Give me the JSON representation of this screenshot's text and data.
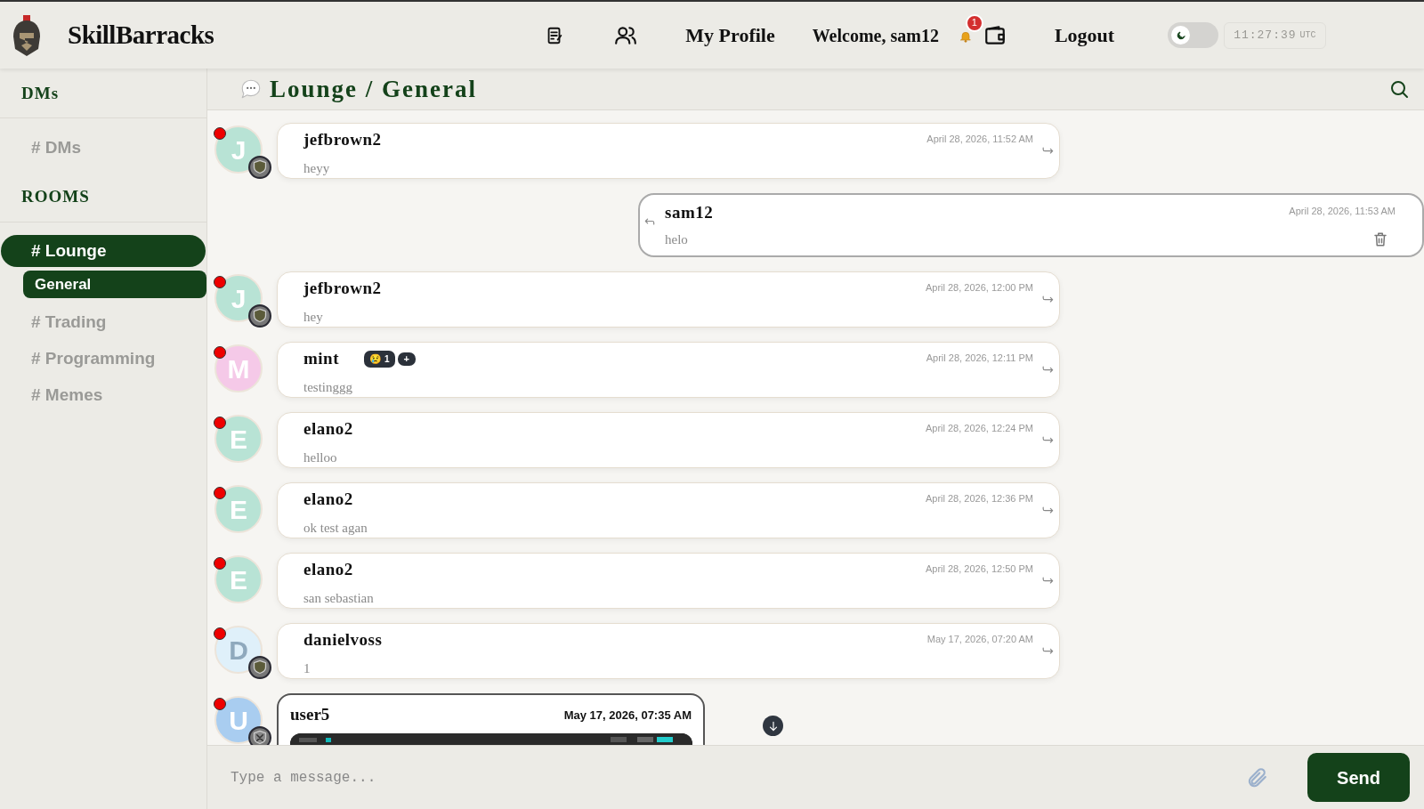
{
  "header": {
    "brand": "SkillBarracks",
    "nav": [
      "My Profile"
    ],
    "welcome": "Welcome, sam12",
    "notifications": "1",
    "logout": "Logout",
    "dark_mode": {
      "on": false
    },
    "clock": {
      "time": "11:27:39",
      "zone": "UTC"
    }
  },
  "sidebar": {
    "sections": [
      {
        "title": "DMs",
        "items": [
          {
            "label": "# DMs",
            "selected": false
          }
        ]
      },
      {
        "title": "ROOMS",
        "items": [
          {
            "label": "# Lounge",
            "selected": true,
            "children": [
              {
                "label": "General",
                "selected": true
              }
            ]
          },
          {
            "label": "# Trading",
            "selected": false
          },
          {
            "label": "# Programming",
            "selected": false
          },
          {
            "label": "# Memes",
            "selected": false
          }
        ]
      }
    ]
  },
  "room": {
    "title": "Lounge / General"
  },
  "messages": [
    {
      "kind": "text",
      "own": false,
      "initial": "J",
      "color": "#b8e3d5",
      "badge": {
        "kind": "shield"
      },
      "user": "jefbrown2",
      "time": "April 28, 2026, 11:52 AM",
      "text": "heyy"
    },
    {
      "kind": "text",
      "own": true,
      "user": "sam12",
      "time": "April 28, 2026, 11:53 AM",
      "text": "helo"
    },
    {
      "kind": "text",
      "own": false,
      "initial": "J",
      "color": "#b8e3d5",
      "badge": {
        "kind": "shield"
      },
      "user": "jefbrown2",
      "time": "April 28, 2026, 12:00 PM",
      "text": "hey"
    },
    {
      "kind": "text",
      "own": false,
      "initial": "M",
      "color": "#f5c9e8",
      "user": "mint",
      "time": "April 28, 2026, 12:11 PM",
      "text": "testinggg",
      "reactions": [
        {
          "emoji": "😢",
          "count": "1"
        }
      ],
      "add_reaction": "+"
    },
    {
      "kind": "text",
      "own": false,
      "initial": "E",
      "color": "#b8e3d5",
      "user": "elano2",
      "time": "April 28, 2026, 12:24 PM",
      "text": "helloo"
    },
    {
      "kind": "text",
      "own": false,
      "initial": "E",
      "color": "#b8e3d5",
      "user": "elano2",
      "time": "April 28, 2026, 12:36 PM",
      "text": "ok test agan"
    },
    {
      "kind": "text",
      "own": false,
      "initial": "E",
      "color": "#b8e3d5",
      "user": "elano2",
      "time": "April 28, 2026, 12:50 PM",
      "text": "san sebastian"
    },
    {
      "kind": "text",
      "own": false,
      "initial": "D",
      "color": "#dff0fa",
      "badge": {
        "kind": "shield"
      },
      "user": "danielvoss",
      "time": "May 17, 2026, 07:20 AM",
      "text": "1"
    },
    {
      "own": false,
      "initial": "U",
      "color": "#a9cdf0",
      "badge": {
        "kind": "crossed"
      },
      "user": "user5",
      "time": "May 17, 2026, 07:35 AM"
    }
  ],
  "composer": {
    "placeholder": "Type a message...",
    "send": "Send"
  }
}
